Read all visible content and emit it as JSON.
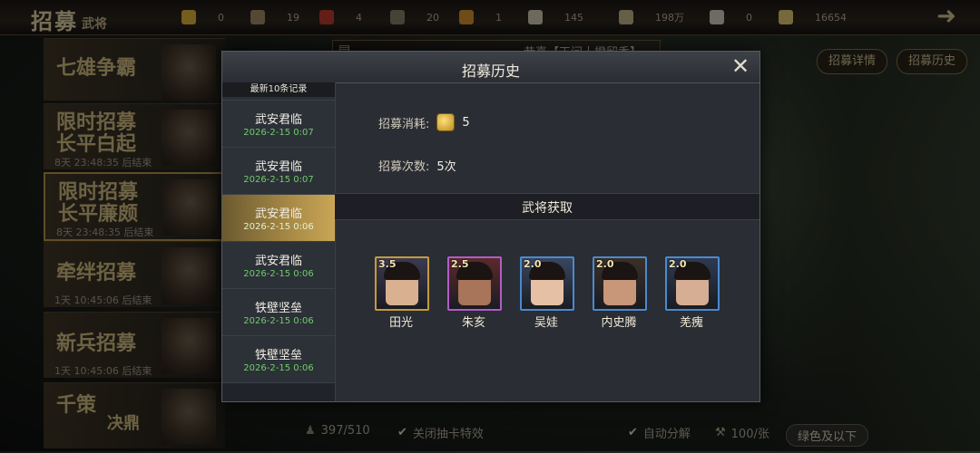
{
  "topbar": {
    "title_main": "招募",
    "title_sub": "武将",
    "resources": [
      {
        "icon": "gold-token-icon",
        "value": "0",
        "color": "#d6a83a"
      },
      {
        "icon": "scroll-ticket-icon",
        "value": "19",
        "color": "#9a8660"
      },
      {
        "icon": "red-badge-icon",
        "value": "4",
        "color": "#b43a2a"
      },
      {
        "icon": "book-icon",
        "value": "20",
        "color": "#7d7a66"
      },
      {
        "icon": "flag-icon",
        "value": "1",
        "color": "#c9892c"
      },
      {
        "icon": "spiral-icon",
        "value": "145",
        "color": "#c6c0a8"
      },
      {
        "icon": "copper-coin-icon",
        "value": "198万",
        "color": "#b8ad83"
      },
      {
        "icon": "silver-ingot-icon",
        "value": "0",
        "color": "#c9c4b8"
      },
      {
        "icon": "gold-ingot-icon",
        "value": "16654",
        "color": "#d8c070"
      }
    ]
  },
  "background_list": [
    {
      "title": "七雄争霸"
    },
    {
      "title": "限时招募",
      "title2": "长平白起",
      "sub": "8天 23:48:35 后结束"
    },
    {
      "title": "限时招募",
      "title2": "长平廉颇",
      "sub": "8天 23:48:35 后结束"
    },
    {
      "title": "牵绊招募",
      "sub": "1天 10:45:06 后结束"
    },
    {
      "title": "新兵招募",
      "sub": "1天 10:45:06 后结束"
    },
    {
      "title": "千策",
      "title2": "决鼎"
    }
  ],
  "right_tabs": {
    "detail": "招募详情",
    "history": "招募历史"
  },
  "announcement": "恭喜【天问丨橙留香】",
  "bottombar": {
    "capacity": "397/510",
    "close_effect": "关闭抽卡特效",
    "auto_decompose": "自动分解",
    "price": "100/张",
    "quality_filter": "绿色及以下"
  },
  "modal": {
    "title": "招募历史",
    "list_header": "最新10条记录",
    "records": [
      {
        "name": "",
        "date": "2026-2-15 0:07"
      },
      {
        "name": "武安君临",
        "date": "2026-2-15 0:07"
      },
      {
        "name": "武安君临",
        "date": "2026-2-15 0:07"
      },
      {
        "name": "武安君临",
        "date": "2026-2-15 0:06"
      },
      {
        "name": "武安君临",
        "date": "2026-2-15 0:06"
      },
      {
        "name": "铁壁坚垒",
        "date": "2026-2-15 0:06"
      },
      {
        "name": "铁壁坚垒",
        "date": "2026-2-15 0:06"
      }
    ],
    "selected_index": 3,
    "cost_label": "招募消耗:",
    "cost_value": "5",
    "count_label": "招募次数:",
    "count_value": "5次",
    "section_title": "武将获取",
    "heroes": [
      {
        "name": "田光",
        "rating": "3.5",
        "border": "#c49a3e",
        "bg": "#3c3a50",
        "skin": "#d9b090"
      },
      {
        "name": "朱亥",
        "rating": "2.5",
        "border": "#b25cc8",
        "bg": "#5a2a2a",
        "skin": "#a8745a"
      },
      {
        "name": "吴娃",
        "rating": "2.0",
        "border": "#4a8ad0",
        "bg": "#3a4660",
        "skin": "#e6c0a4"
      },
      {
        "name": "内史腾",
        "rating": "2.0",
        "border": "#4a8ad0",
        "bg": "#3a3028",
        "skin": "#c89678"
      },
      {
        "name": "羌瘣",
        "rating": "2.0",
        "border": "#4a8ad0",
        "bg": "#2e3a50",
        "skin": "#d6ae94"
      }
    ]
  }
}
